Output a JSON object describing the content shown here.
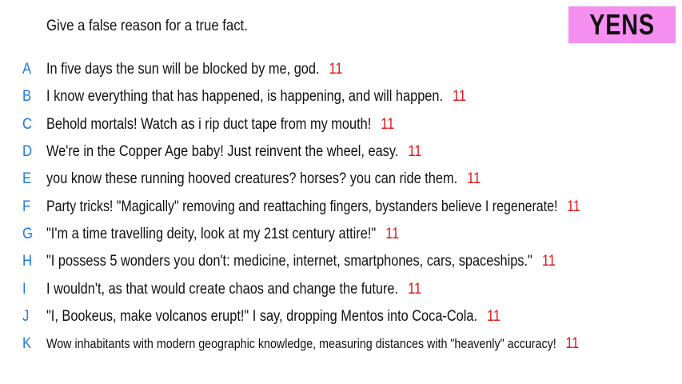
{
  "prompt": "Give a false reason for a true fact.",
  "brand": "YENS",
  "colors": {
    "letter": "#1e7be0",
    "score": "#e01818",
    "brand_bg": "#f58ff0",
    "text": "#111111"
  },
  "answers": [
    {
      "letter": "A",
      "text": "In five days the sun will be blocked by me, god.",
      "score": "11"
    },
    {
      "letter": "B",
      "text": "I know everything that has happened, is happening, and will happen.",
      "score": "11"
    },
    {
      "letter": "C",
      "text": "Behold mortals! Watch as i rip duct tape from my mouth!",
      "score": "11"
    },
    {
      "letter": "D",
      "text": "We're in the Copper Age baby! Just reinvent the wheel, easy.",
      "score": "11"
    },
    {
      "letter": "E",
      "text": "you know these running hooved creatures? horses? you can ride them.",
      "score": "11"
    },
    {
      "letter": "F",
      "text": "Party tricks! \"Magically\" removing and reattaching fingers, bystanders believe I regenerate!",
      "score": "11"
    },
    {
      "letter": "G",
      "text": "\"I'm a time travelling deity, look at my 21st century attire!\"",
      "score": "11"
    },
    {
      "letter": "H",
      "text": "\"I possess 5 wonders you don't: medicine, internet, smartphones, cars, spaceships.\"",
      "score": "11"
    },
    {
      "letter": "I",
      "text": "I wouldn't, as that would create chaos and change the future.",
      "score": "11"
    },
    {
      "letter": "J",
      "text": "\"I, Bookeus, make volcanos erupt!\" I say, dropping Mentos into Coca-Cola.",
      "score": "11"
    },
    {
      "letter": "K",
      "text": "Wow inhabitants with modern geographic knowledge, measuring distances with \"heavenly\" accuracy!",
      "score": "11"
    }
  ]
}
